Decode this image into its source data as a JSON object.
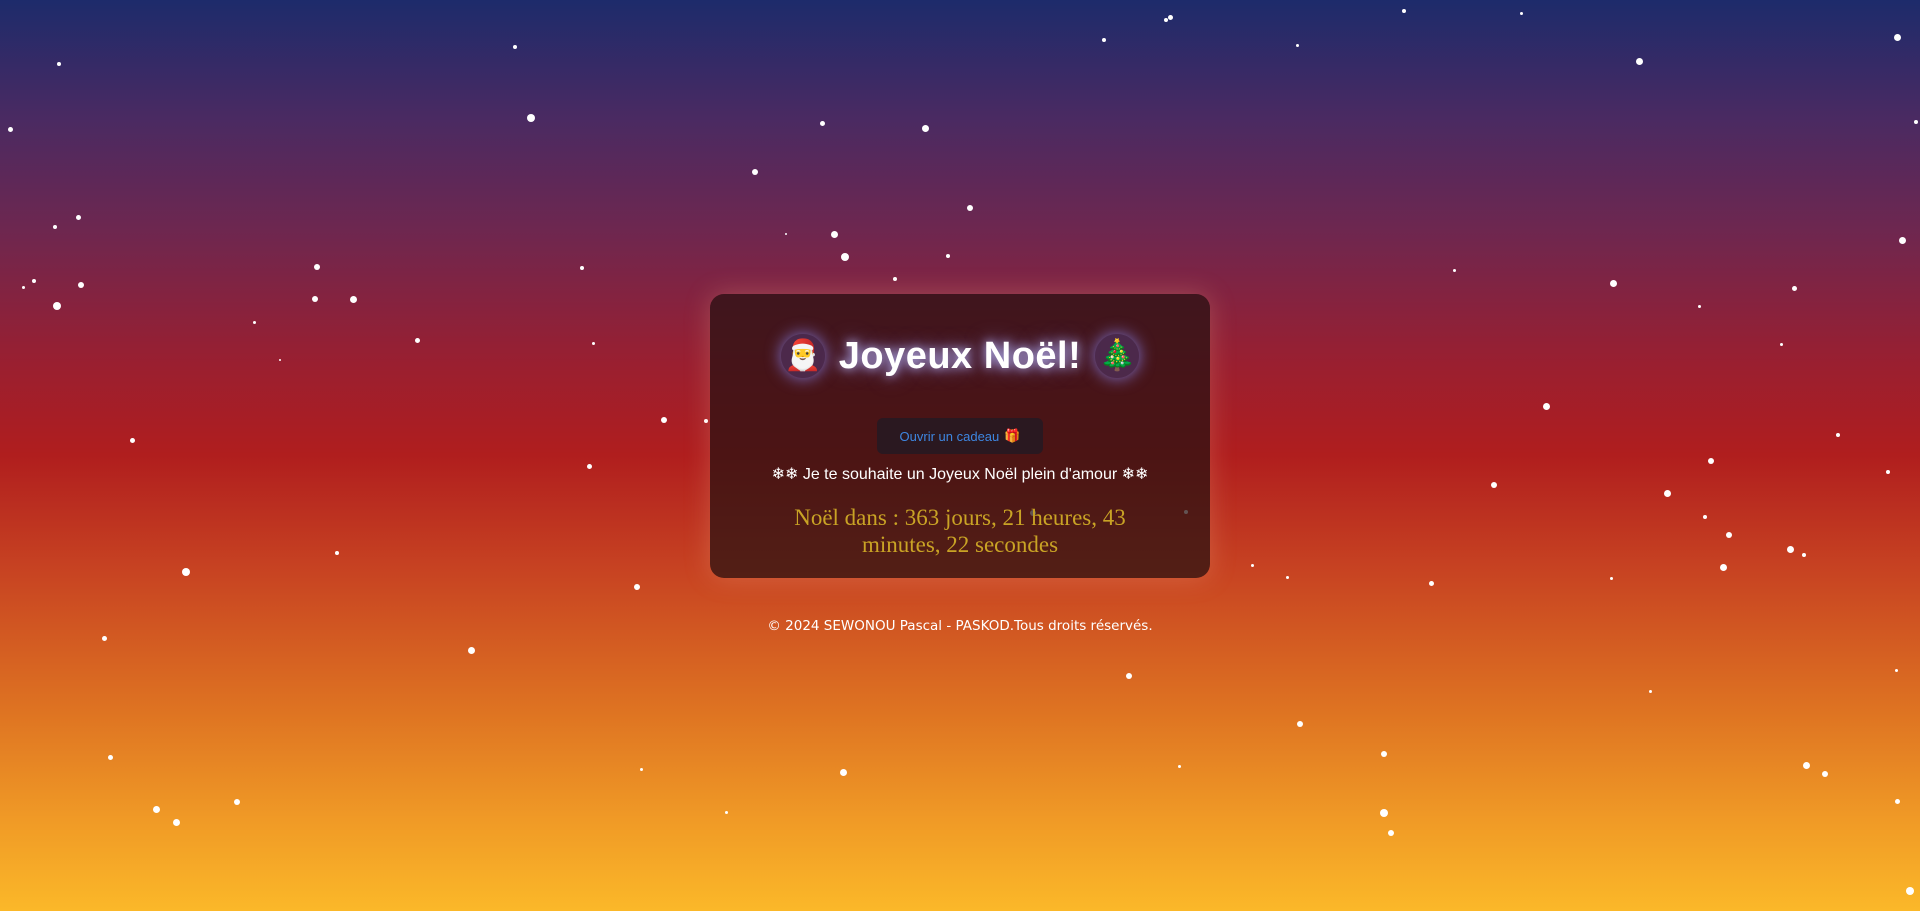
{
  "title": {
    "text": "Joyeux Noël!",
    "left_emoji": "🎅",
    "left_icon": "santa-icon",
    "right_emoji": "🎄",
    "right_icon": "christmas-tree-icon"
  },
  "gift_button": {
    "label": "Ouvrir un cadeau",
    "icon_glyph": "🎁",
    "icon": "gift-icon"
  },
  "message": "❄❄ Je te souhaite un Joyeux Noël plein d'amour ❄❄",
  "countdown": "Noël dans : 363 jours, 21 heures, 43 minutes, 22 secondes",
  "footer": "© 2024 SEWONOU Pascal - PASKOD.Tous droits réservés.",
  "colors": {
    "countdown_text": "#c9a325",
    "button_text": "#3e86e0",
    "card_bg": "#261010",
    "gradient_top": "#1d2b6b",
    "gradient_mid": "#b01e1e",
    "gradient_bottom": "#fbb829"
  }
}
